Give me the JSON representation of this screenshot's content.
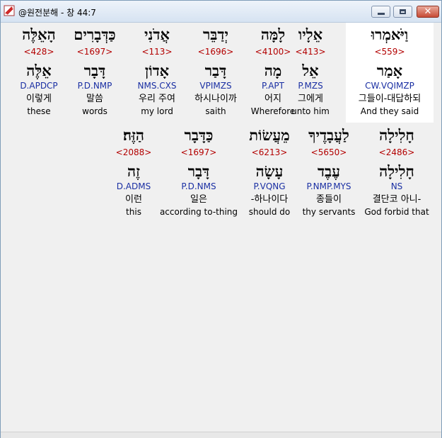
{
  "window": {
    "title": "@원전분해 - 창 44:7",
    "close_glyph": "✕"
  },
  "rows": [
    {
      "words": [
        {
          "hebrew": "וַיֹּאמְרוּ",
          "strong": "<559>",
          "lemma": "אָמַר",
          "morph": "CW.VQIMZP",
          "korean": "그들이-대답하되",
          "english": "And they said"
        },
        {
          "hebrew": "אֵלָיו",
          "strong": "<413>",
          "lemma": "אֵל",
          "morph": "P.MZS",
          "korean": "그에게",
          "english": "unto him"
        },
        {
          "hebrew": "לָמָּה",
          "strong": "<4100>",
          "lemma": "מָה",
          "morph": "P.APT",
          "korean": "어지",
          "english": "Wherefore"
        },
        {
          "hebrew": "יְדַבֵּר",
          "strong": "<1696>",
          "lemma": "דָּבַר",
          "morph": "VPIMZS",
          "korean": "하시나이까",
          "english": "saith"
        },
        {
          "hebrew": "אֲדֹנִי",
          "strong": "<113>",
          "lemma": "אָדוֹן",
          "morph": "NMS.CXS",
          "korean": "우리 주여",
          "english": "my lord"
        },
        {
          "hebrew": "כַּדְּבָרִים",
          "strong": "<1697>",
          "lemma": "דָּבָר",
          "morph": "P.D.NMP",
          "korean": "말씀",
          "english": "words"
        },
        {
          "hebrew": "הָאֵלֶּה",
          "strong": "<428>",
          "lemma": "אֵלֶּה",
          "morph": "D.APDCP",
          "korean": "이렇게",
          "english": "these"
        }
      ]
    },
    {
      "words": [
        {
          "hebrew": "חָלִילָה",
          "strong": "<2486>",
          "lemma": "חָלִילָה",
          "morph": "NS",
          "korean": "결단코 아니-",
          "english": "God forbid that"
        },
        {
          "hebrew": "לַעֲבָדֶיךָ",
          "strong": "<5650>",
          "lemma": "עֶבֶד",
          "morph": "P.NMP.MYS",
          "korean": "종들이",
          "english": "thy servants"
        },
        {
          "hebrew": "מֵעֲשׂוֹת",
          "strong": "<6213>",
          "lemma": "עָשָׂה",
          "morph": "P.VQNG",
          "korean": "-하나이다",
          "english": "should do"
        },
        {
          "hebrew": "כַּדָּבָר",
          "strong": "<1697>",
          "lemma": "דָּבָר",
          "morph": "P.D.NMS",
          "korean": "일은",
          "english": "according to-thing"
        },
        {
          "hebrew": "הַזֶּה׃",
          "strong": "<2088>",
          "lemma": "זֶה",
          "morph": "D.ADMS",
          "korean": "이런",
          "english": "this"
        }
      ]
    }
  ]
}
